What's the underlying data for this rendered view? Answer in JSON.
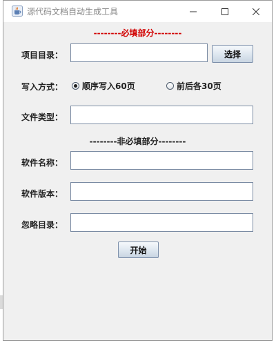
{
  "window": {
    "title": "源代码文档自动生成工具",
    "icon": "java-cup-icon"
  },
  "sections": {
    "required": "--------必填部分--------",
    "optional": "--------非必填部分--------"
  },
  "form": {
    "project_dir": {
      "label": "项目目录：",
      "value": "",
      "button": "选择"
    },
    "write_mode": {
      "label": "写入方式：",
      "options": [
        "顺序写入60页",
        "前后各30页"
      ],
      "selected": "顺序写入60页"
    },
    "file_type": {
      "label": "文件类型：",
      "value": ""
    },
    "software_name": {
      "label": "软件名称：",
      "value": ""
    },
    "software_version": {
      "label": "软件版本：",
      "value": ""
    },
    "ignore_dir": {
      "label": "忽略目录：",
      "value": ""
    },
    "start_button": "开始"
  },
  "colors": {
    "required_section": "#d10000",
    "window_bg": "#f0f0f0"
  }
}
